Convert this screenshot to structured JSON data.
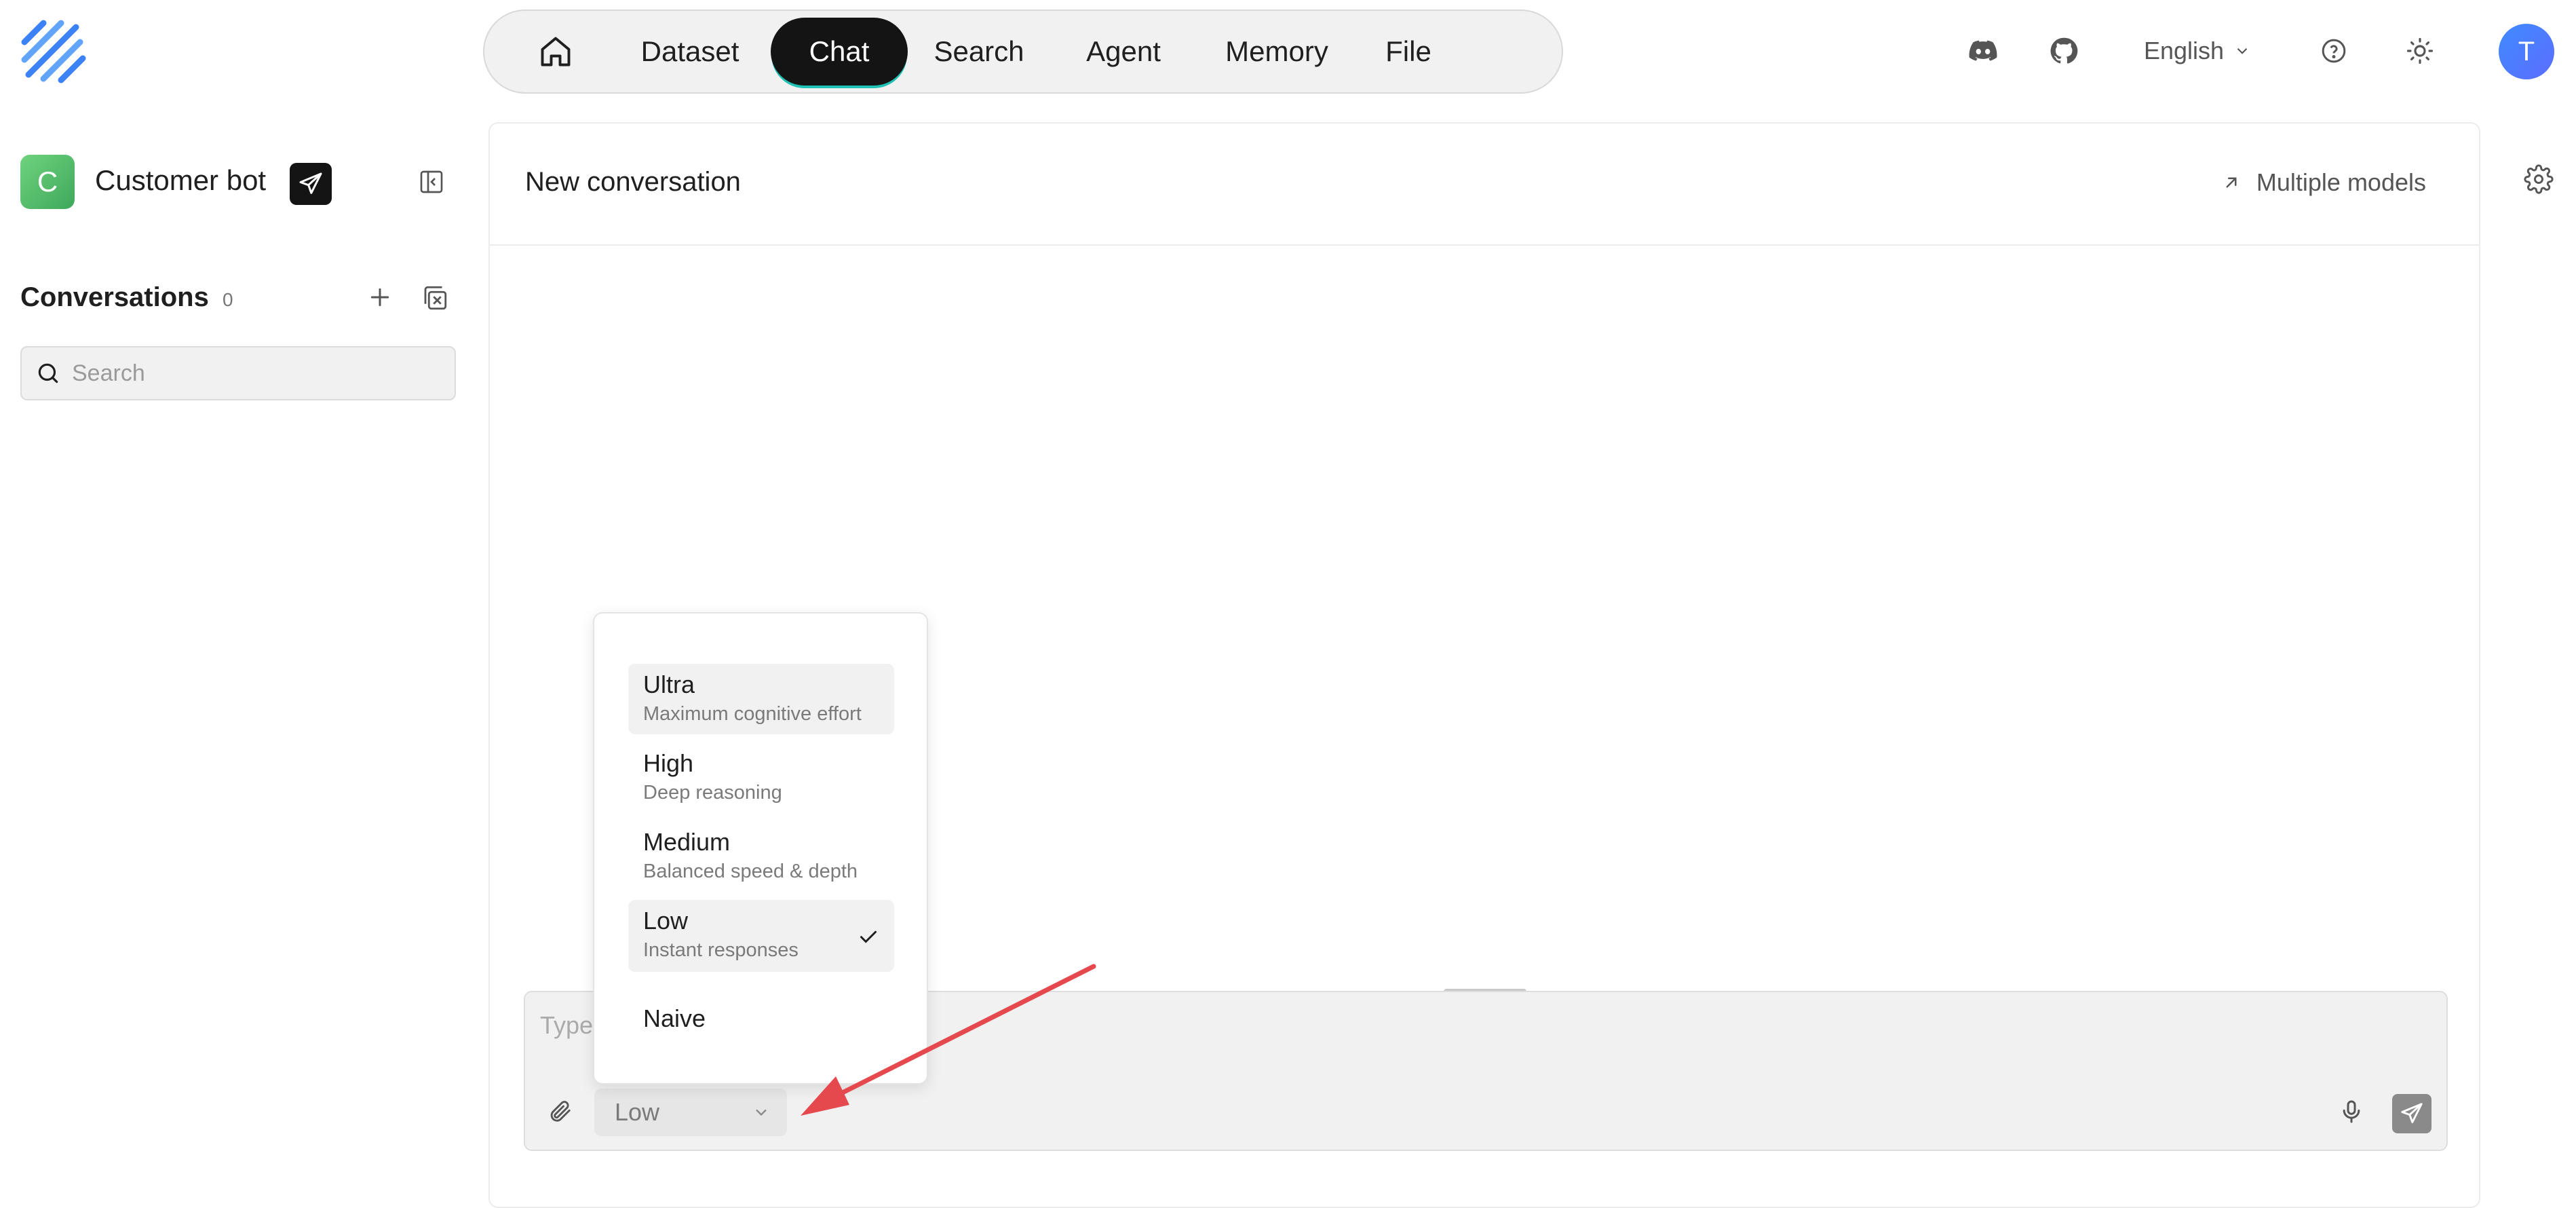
{
  "nav": {
    "items": [
      {
        "label": "Dataset"
      },
      {
        "label": "Chat"
      },
      {
        "label": "Search"
      },
      {
        "label": "Agent"
      },
      {
        "label": "Memory"
      },
      {
        "label": "File"
      }
    ],
    "active": "Chat"
  },
  "header": {
    "language": "English",
    "user_initial": "T"
  },
  "sidebar": {
    "bot_initial": "C",
    "bot_name": "Customer bot",
    "conversations_label": "Conversations",
    "conversations_count": "0",
    "search_placeholder": "Search"
  },
  "main": {
    "title": "New conversation",
    "multiple_models": "Multiple models"
  },
  "composer": {
    "placeholder": "Type",
    "effort_value": "Low"
  },
  "effort_menu": {
    "options": [
      {
        "label": "Ultra",
        "desc": "Maximum cognitive effort"
      },
      {
        "label": "High",
        "desc": "Deep reasoning"
      },
      {
        "label": "Medium",
        "desc": "Balanced speed & depth"
      },
      {
        "label": "Low",
        "desc": "Instant responses"
      },
      {
        "label": "Naive",
        "desc": ""
      }
    ],
    "selected": "Low"
  },
  "colors": {
    "accent": "#1fc2b4",
    "annotation_arrow": "#e5484d",
    "bot_avatar": "#4caf50",
    "user_avatar": "#3f8cff"
  }
}
